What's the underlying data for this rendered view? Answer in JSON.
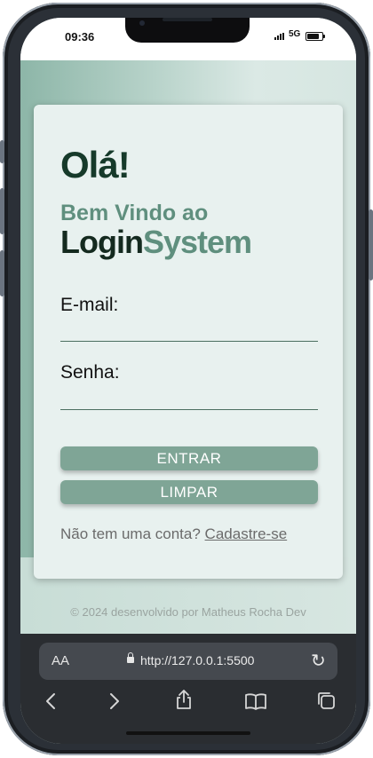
{
  "status_bar": {
    "time": "09:36",
    "network": "5G"
  },
  "login": {
    "greeting": "Olá!",
    "welcome": "Bem Vindo ao",
    "brand_part1": "Login",
    "brand_part2": "System",
    "email_label": "E-mail:",
    "email_value": "",
    "password_label": "Senha:",
    "password_value": "",
    "submit_label": "ENTRAR",
    "clear_label": "LIMPAR",
    "signup_prompt": "Não tem uma conta?",
    "signup_link": "Cadastre-se"
  },
  "footer": {
    "text": "© 2024 desenvolvido por Matheus Rocha Dev"
  },
  "browser": {
    "text_size_label": "AA",
    "url": "http://127.0.0.1:5500",
    "icons": [
      "back-icon",
      "forward-icon",
      "share-icon",
      "bookmarks-icon",
      "tabs-icon",
      "reload-icon",
      "lock-icon"
    ]
  },
  "colors": {
    "accent": "#7fa596",
    "brand_dark": "#142a1f",
    "brand_green": "#5f8f7e"
  }
}
